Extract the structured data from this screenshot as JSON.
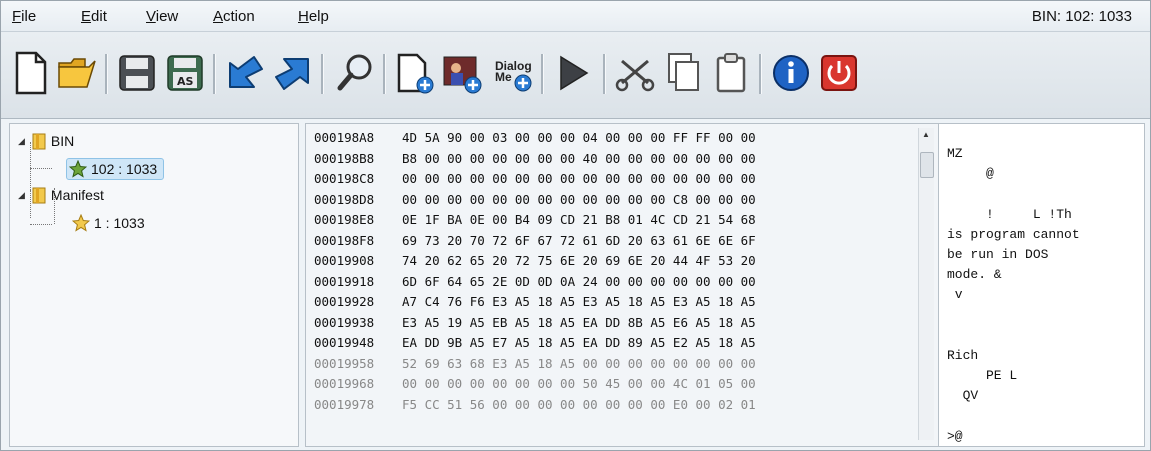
{
  "menu": {
    "file": {
      "u": "F",
      "rest": "ile"
    },
    "edit": {
      "u": "E",
      "rest": "dit"
    },
    "view": {
      "u": "V",
      "rest": "iew"
    },
    "action": {
      "u": "A",
      "rest": "ction"
    },
    "help": {
      "u": "H",
      "rest": "elp"
    }
  },
  "status": "BIN: 102: 1033",
  "toolbar": {
    "dialog_text_1": "Dialog",
    "dialog_text_2": "Me"
  },
  "tree": {
    "bin": "BIN",
    "bin_child": "102 : 1033",
    "manifest": "Manifest",
    "manifest_child": "1 : 1033"
  },
  "hex": {
    "rows": [
      {
        "addr": "000198A8",
        "bytes": "4D 5A 90 00 03 00 00 00 04 00 00 00 FF FF 00 00"
      },
      {
        "addr": "000198B8",
        "bytes": "B8 00 00 00 00 00 00 00 40 00 00 00 00 00 00 00"
      },
      {
        "addr": "000198C8",
        "bytes": "00 00 00 00 00 00 00 00 00 00 00 00 00 00 00 00"
      },
      {
        "addr": "000198D8",
        "bytes": "00 00 00 00 00 00 00 00 00 00 00 00 C8 00 00 00"
      },
      {
        "addr": "000198E8",
        "bytes": "0E 1F BA 0E 00 B4 09 CD 21 B8 01 4C CD 21 54 68"
      },
      {
        "addr": "000198F8",
        "bytes": "69 73 20 70 72 6F 67 72 61 6D 20 63 61 6E 6E 6F"
      },
      {
        "addr": "00019908",
        "bytes": "74 20 62 65 20 72 75 6E 20 69 6E 20 44 4F 53 20"
      },
      {
        "addr": "00019918",
        "bytes": "6D 6F 64 65 2E 0D 0D 0A 24 00 00 00 00 00 00 00"
      },
      {
        "addr": "00019928",
        "bytes": "A7 C4 76 F6 E3 A5 18 A5 E3 A5 18 A5 E3 A5 18 A5"
      },
      {
        "addr": "00019938",
        "bytes": "E3 A5 19 A5 EB A5 18 A5 EA DD 8B A5 E6 A5 18 A5"
      },
      {
        "addr": "00019948",
        "bytes": "EA DD 9B A5 E7 A5 18 A5 EA DD 89 A5 E2 A5 18 A5"
      },
      {
        "addr": "00019958",
        "bytes": "52 69 63 68 E3 A5 18 A5 00 00 00 00 00 00 00 00"
      },
      {
        "addr": "00019968",
        "bytes": "00 00 00 00 00 00 00 00 50 45 00 00 4C 01 05 00"
      },
      {
        "addr": "00019978",
        "bytes": "F5 CC 51 56 00 00 00 00 00 00 00 00 E0 00 02 01"
      }
    ]
  },
  "text_lines": [
    {
      "text": "MZ"
    },
    {
      "text": "     @"
    },
    {
      "text": ""
    },
    {
      "text": "     !     L !Th"
    },
    {
      "text": "is program cannot"
    },
    {
      "text": "be run in DOS"
    },
    {
      "text": "mode. &"
    },
    {
      "text": " v"
    },
    {
      "text": ""
    },
    {
      "text": ""
    },
    {
      "text": "Rich"
    },
    {
      "text": "     PE L"
    },
    {
      "text": "  QV"
    },
    {
      "text": ""
    },
    {
      "text": ">@"
    }
  ]
}
